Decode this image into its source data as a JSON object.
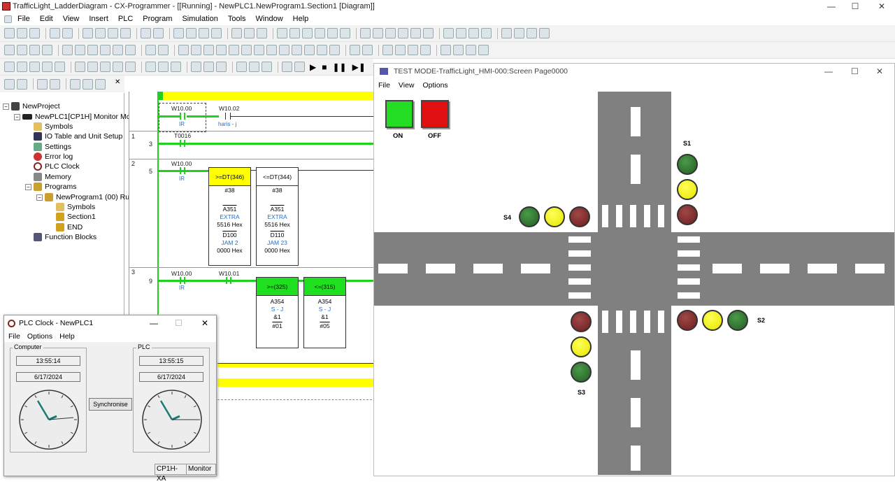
{
  "app": {
    "title": "TrafficLight_LadderDiagram - CX-Programmer - [[Running] - NewPLC1.NewProgram1.Section1 [Diagram]]",
    "minimize": "—",
    "maximize": "☐",
    "close": "✕"
  },
  "menu": [
    "File",
    "Edit",
    "View",
    "Insert",
    "PLC",
    "Program",
    "Simulation",
    "Tools",
    "Window",
    "Help"
  ],
  "tree": {
    "root": "NewProject",
    "plc": "NewPLC1[CP1H] Monitor Mc",
    "symbols": "Symbols",
    "io_table": "IO Table and Unit Setup",
    "settings": "Settings",
    "error_log": "Error log",
    "plc_clock": "PLC Clock",
    "memory": "Memory",
    "programs": "Programs",
    "program1": "NewProgram1 (00) Ru",
    "prog_symbols": "Symbols",
    "section1": "Section1",
    "end": "END",
    "function_blocks": "Function Blocks"
  },
  "ladder": {
    "rung0": {
      "contact1": "W10.00",
      "contact1_sub": "IR",
      "contact2": "W10.02",
      "contact2_sub": "haris - j"
    },
    "rung1": {
      "num": "1",
      "addr": "3",
      "contact1": "T0016"
    },
    "rung2": {
      "num": "2",
      "addr": "5",
      "contact1": "W10.00",
      "contact1_sub": "IR",
      "block1": {
        "head": "&gt;=DT(346)",
        "l1": "#38",
        "l2": "A351",
        "l3": "EXTRA",
        "l4": "5516 Hex",
        "l5": "D100",
        "l6": "JAM 2",
        "l7": "0000 Hex"
      },
      "block2": {
        "head": "&lt;=DT(344)",
        "l1": "#38",
        "l2": "A351",
        "l3": "EXTRA",
        "l4": "5516 Hex",
        "l5": "D110",
        "l6": "JAM 23",
        "l7": "0000 Hex"
      }
    },
    "rung3": {
      "num": "3",
      "addr": "9",
      "contact1": "W10.00",
      "contact1_sub": "IR",
      "contact2": "W10.01",
      "block1": {
        "head": "&gt;=(325)",
        "l1": "A354",
        "l2": "S - J",
        "l3": "&amp;1",
        "l4": "#01"
      },
      "block2": {
        "head": "&lt;=(315)",
        "l1": "A354",
        "l2": "S - J",
        "l3": "&amp;1",
        "l4": "#05"
      }
    }
  },
  "hmi": {
    "title": "TEST MODE-TrafficLight_HMI-000:Screen Page0000",
    "menu": [
      "File",
      "View",
      "Options"
    ],
    "on_label": "ON",
    "off_label": "OFF",
    "s1": "S1",
    "s2": "S2",
    "s3": "S3",
    "s4": "S4",
    "colors": {
      "on": "#22dd22",
      "off": "#e01010",
      "road": "#808080"
    }
  },
  "clock": {
    "title": "PLC Clock - NewPLC1",
    "menu": [
      "File",
      "Options",
      "Help"
    ],
    "computer_label": "Computer",
    "plc_label": "PLC",
    "computer_time": "13:55:14",
    "computer_date": "6/17/2024",
    "plc_time": "13:55:15",
    "plc_date": "6/17/2024",
    "sync": "Synchronise",
    "status_model": "CP1H-XA",
    "status_mode": "Monitor"
  }
}
